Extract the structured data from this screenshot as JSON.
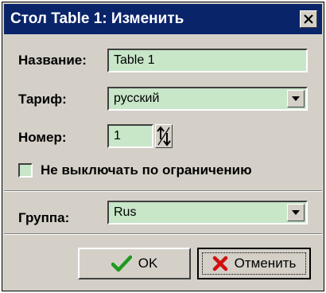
{
  "window": {
    "title": "Стол Table 1: Изменить"
  },
  "fields": {
    "name": {
      "label": "Название:",
      "value": "Table 1"
    },
    "tariff": {
      "label": "Тариф:",
      "value": "русский"
    },
    "number": {
      "label": "Номер:",
      "value": "1"
    },
    "no_switch_off": {
      "label": "Не выключать по ограничению",
      "checked": false
    },
    "group": {
      "label": "Группа:",
      "value": "Rus"
    }
  },
  "buttons": {
    "ok": "OK",
    "cancel": "Отменить"
  },
  "icons": {
    "close": "close-icon",
    "dropdown": "chevron-down-icon",
    "spin": "spin-arrows-icon",
    "ok": "green-checkmark-icon",
    "cancel": "red-x-icon"
  },
  "colors": {
    "title_bar": "#0a246a",
    "field_bg": "#c8e6c8",
    "face": "#d4d0c8",
    "ok_check": "#1e9a1e",
    "cancel_x": "#d01010"
  }
}
